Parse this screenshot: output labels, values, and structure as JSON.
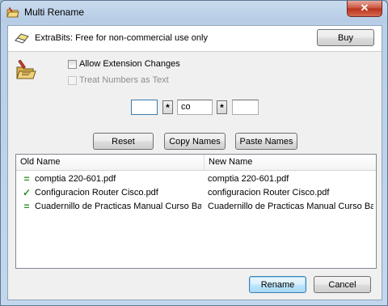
{
  "window": {
    "title": "Multi Rename",
    "close_label": "✕"
  },
  "banner": {
    "text": "ExtraBits: Free for non-commercial use only",
    "buy_label": "Buy"
  },
  "options": {
    "allow_extension_changes": {
      "label": "Allow Extension Changes",
      "checked": false,
      "enabled": true
    },
    "treat_numbers_as_text": {
      "label": "Treat Numbers as Text",
      "checked": false,
      "enabled": false
    }
  },
  "pattern": {
    "field1_value": "",
    "star1_label": "*",
    "field2_value": "co",
    "star2_label": "*",
    "field3_value": ""
  },
  "actions": {
    "reset_label": "Reset",
    "copy_names_label": "Copy Names",
    "paste_names_label": "Paste Names"
  },
  "list": {
    "columns": [
      "Old Name",
      "New Name"
    ],
    "rows": [
      {
        "status": "=",
        "status_icon": "equal-icon",
        "old": "comptia 220-601.pdf",
        "new": "comptia 220-601.pdf"
      },
      {
        "status": "✓",
        "status_icon": "checkmark-icon",
        "old": "Configuracion Router Cisco.pdf",
        "new": "configuracion Router Cisco.pdf"
      },
      {
        "status": "=",
        "status_icon": "equal-icon",
        "old": "Cuadernillo de Practicas Manual Curso Basic...",
        "new": "Cuadernillo de Practicas Manual Curso Basi..."
      }
    ]
  },
  "footer": {
    "rename_label": "Rename",
    "cancel_label": "Cancel"
  },
  "colors": {
    "status_green": "#2d8f2d",
    "default_button_border": "#3c7fb1",
    "close_button": "#c7503a"
  }
}
